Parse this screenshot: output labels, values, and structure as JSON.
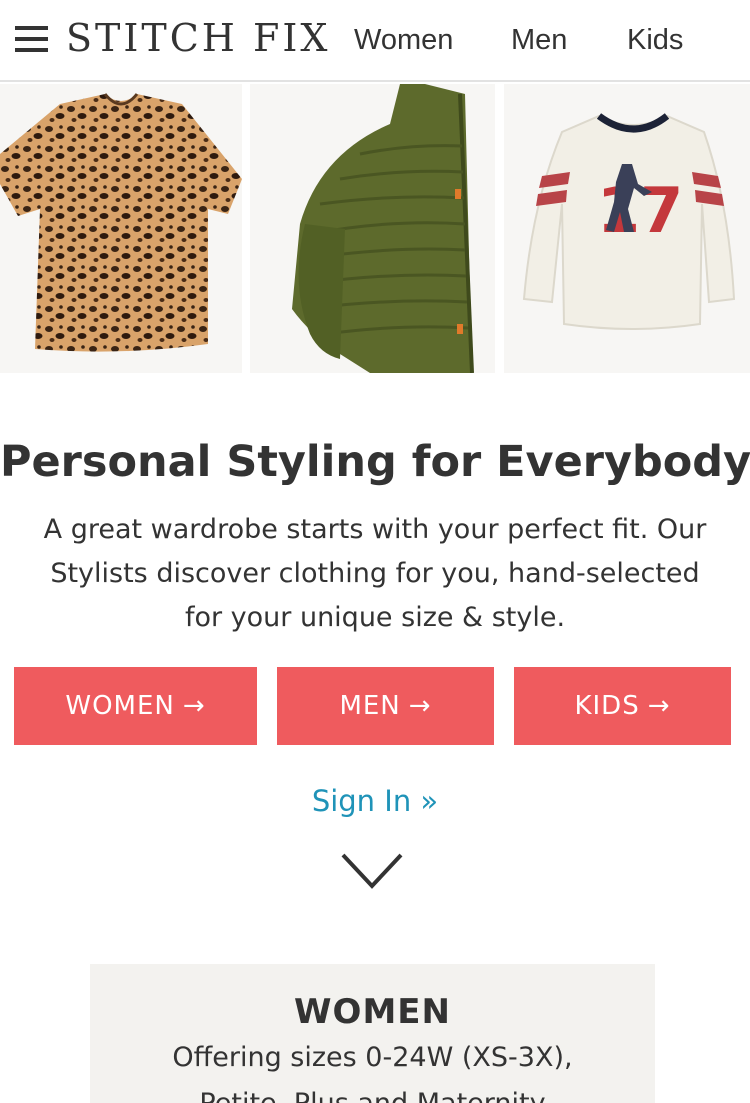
{
  "header": {
    "logo": "STITCH FIX",
    "nav": {
      "women": "Women",
      "men": "Men",
      "kids": "Kids"
    }
  },
  "products": [
    {
      "icon": "leopard-print-top-image"
    },
    {
      "icon": "green-puffer-jacket-image"
    },
    {
      "icon": "baseball-tee-image"
    }
  ],
  "hero": {
    "title": "Personal Styling for Everybody",
    "subtitle_lines": [
      "A great wardrobe starts with your perfect fit. Our",
      "Stylists discover clothing for you, hand-selected",
      "for your unique size & style."
    ]
  },
  "cta": {
    "women": "WOMEN",
    "men": "MEN",
    "kids": "KIDS",
    "arrow": "→"
  },
  "signin": "Sign In »",
  "card": {
    "title": "WOMEN",
    "line1": "Offering sizes 0-24W (XS-3X),",
    "line2": "Petite, Plus and Maternity"
  },
  "colors": {
    "accent": "#ef5b5e",
    "link": "#1f93b8",
    "text": "#333333"
  }
}
